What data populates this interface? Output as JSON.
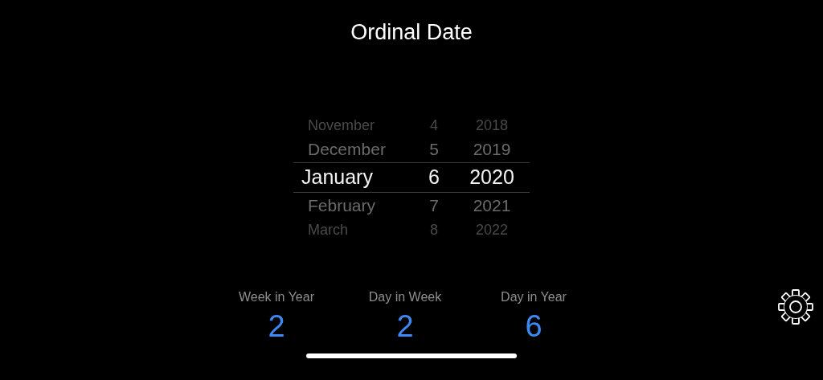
{
  "title": "Ordinal Date",
  "picker_rows": [
    {
      "month": "November",
      "day": "4",
      "year": "2018",
      "selected": false
    },
    {
      "month": "December",
      "day": "5",
      "year": "2019",
      "selected": false
    },
    {
      "month": "January",
      "day": "6",
      "year": "2020",
      "selected": true
    },
    {
      "month": "February",
      "day": "7",
      "year": "2021",
      "selected": false
    },
    {
      "month": "March",
      "day": "8",
      "year": "2022",
      "selected": false
    }
  ],
  "stats": [
    {
      "label": "Week in Year",
      "value": "2"
    },
    {
      "label": "Day in Week",
      "value": "2"
    },
    {
      "label": "Day in Year",
      "value": "6"
    }
  ]
}
